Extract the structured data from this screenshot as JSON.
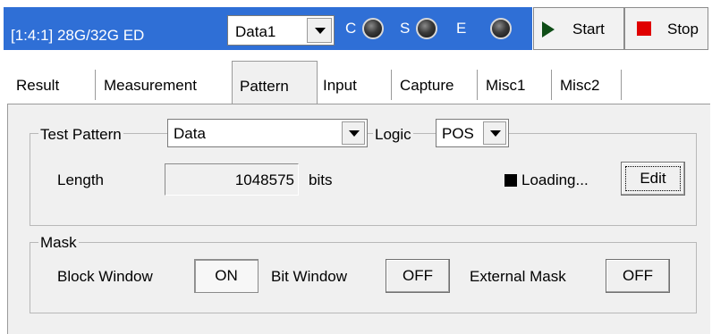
{
  "header": {
    "unit_label": "[1:4:1] 28G/32G ED",
    "data_select": "Data1",
    "leds": [
      {
        "label": "C",
        "icon": "led-indicator"
      },
      {
        "label": "S",
        "icon": "led-indicator"
      },
      {
        "label": "E",
        "icon": "led-indicator"
      }
    ],
    "start_label": "Start",
    "stop_label": "Stop",
    "accent_color": "#2f6fd6"
  },
  "tabs": [
    {
      "label": "Result",
      "active": false
    },
    {
      "label": "Measurement",
      "active": false
    },
    {
      "label": "Pattern",
      "active": true
    },
    {
      "label": "Input",
      "active": false
    },
    {
      "label": "Capture",
      "active": false
    },
    {
      "label": "Misc1",
      "active": false
    },
    {
      "label": "Misc2",
      "active": false
    }
  ],
  "test_pattern": {
    "group_label": "Test Pattern",
    "pattern_value": "Data",
    "logic_label": "Logic",
    "logic_value": "POS",
    "length_label": "Length",
    "length_value": "1048575",
    "length_unit": "bits",
    "loading_label": "Loading...",
    "edit_label": "Edit"
  },
  "mask": {
    "group_label": "Mask",
    "block_window_label": "Block Window",
    "block_window_value": "ON",
    "bit_window_label": "Bit Window",
    "bit_window_value": "OFF",
    "external_mask_label": "External Mask",
    "external_mask_value": "OFF"
  }
}
